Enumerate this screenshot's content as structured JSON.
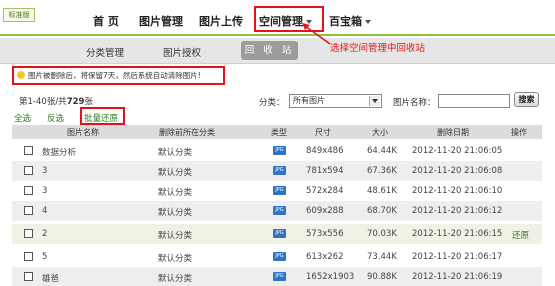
{
  "header": {
    "brand": "标准版",
    "nav": [
      {
        "label": "首 页"
      },
      {
        "label": "图片管理"
      },
      {
        "label": "图片上传"
      },
      {
        "label": "空间管理"
      },
      {
        "label": "百宝箱"
      }
    ]
  },
  "subnav": {
    "items": [
      {
        "label": "分类管理"
      },
      {
        "label": "图片授权"
      },
      {
        "label": "回 收 站"
      }
    ]
  },
  "annotation": {
    "text": "选择空间管理中回收站",
    "color": "#e3121b"
  },
  "notice": {
    "text": "图片被删除后，将保留7天，然后系统自动清除图片!"
  },
  "summary": {
    "prefix": "第",
    "range": "1-40",
    "middle": "张/共",
    "total": "729",
    "suffix": "张"
  },
  "filters": {
    "category_label": "分类：",
    "category_value": "所有图片",
    "name_label": "图片名称：",
    "name_value": "",
    "search_label": "搜索"
  },
  "bulk": {
    "select_all": "全选",
    "invert": "反选",
    "restore": "批量还原"
  },
  "table": {
    "headers": [
      "图片名称",
      "删除前所在分类",
      "类型",
      "尺寸",
      "大小",
      "删除日期",
      "操作"
    ],
    "rows": [
      {
        "name": "数据分析",
        "category": "默认分类",
        "type": "JPG",
        "size": "849x486",
        "filesize": "64.44K",
        "date": "2012-11-20 21:06:05",
        "op": ""
      },
      {
        "name": "3",
        "category": "默认分类",
        "type": "JPG",
        "size": "781x594",
        "filesize": "67.36K",
        "date": "2012-11-20 21:06:08",
        "op": ""
      },
      {
        "name": "3",
        "category": "默认分类",
        "type": "JPG",
        "size": "572x284",
        "filesize": "48.61K",
        "date": "2012-11-20 21:06:10",
        "op": ""
      },
      {
        "name": "4",
        "category": "默认分类",
        "type": "JPG",
        "size": "609x288",
        "filesize": "68.70K",
        "date": "2012-11-20 21:06:12",
        "op": ""
      },
      {
        "name": "2",
        "category": "默认分类",
        "type": "JPG",
        "size": "573x556",
        "filesize": "70.03K",
        "date": "2012-11-20 21:06:15",
        "op": "还原"
      },
      {
        "name": "5",
        "category": "默认分类",
        "type": "JPG",
        "size": "613x262",
        "filesize": "73.44K",
        "date": "2012-11-20 21:06:17",
        "op": ""
      },
      {
        "name": "雄爸",
        "category": "默认分类",
        "type": "JPG",
        "size": "1652x1903",
        "filesize": "90.88K",
        "date": "2012-11-20 21:06:19",
        "op": ""
      }
    ]
  },
  "colors": {
    "accent_green": "#8ac33f",
    "highlight_red": "#e3121b",
    "link_green": "#2a7a1e"
  }
}
